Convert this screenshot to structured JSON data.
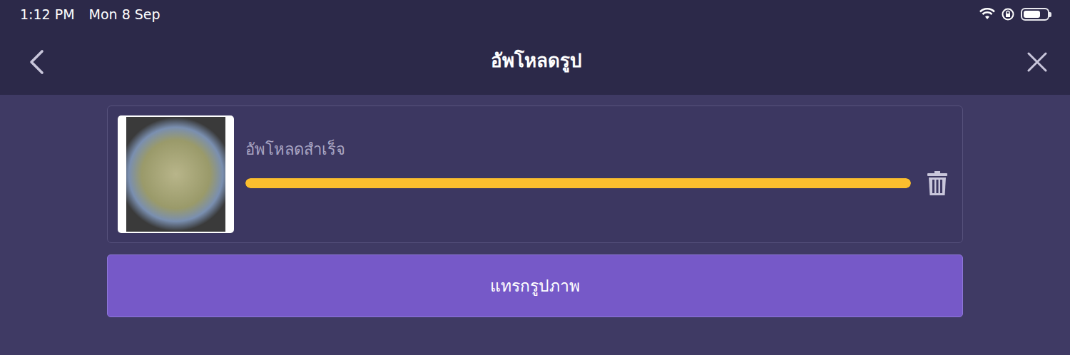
{
  "status_bar": {
    "time": "1:12 PM",
    "date": "Mon 8 Sep",
    "battery": {
      "level": 0.72
    }
  },
  "nav": {
    "title": "อัพโหลดรูป"
  },
  "uploads": [
    {
      "status": "อัพโหลดสำเร็จ",
      "level": 1
    }
  ],
  "buttons": [
    "แทรกรูปภาพ"
  ]
}
